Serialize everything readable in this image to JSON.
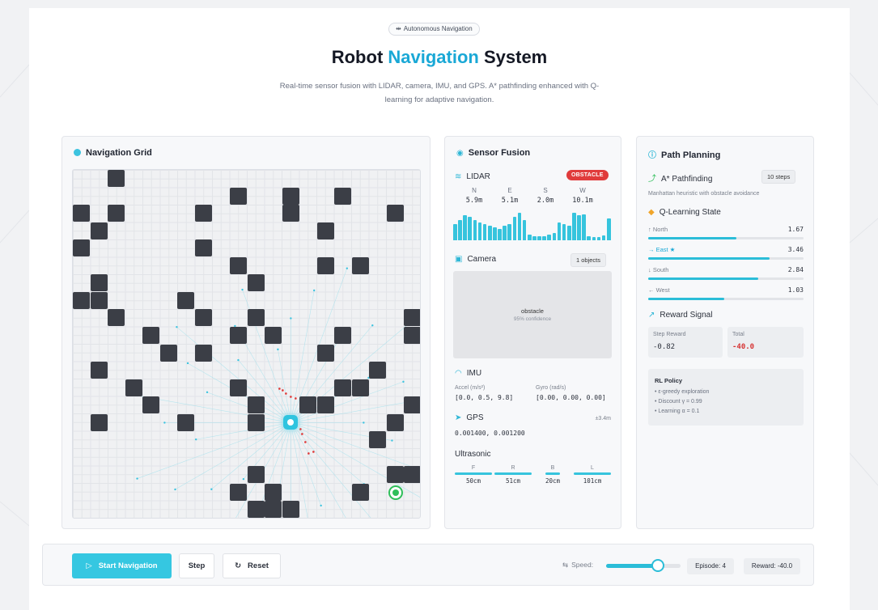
{
  "header": {
    "tag_icon": "link-icon",
    "tag": "Autonomous Navigation",
    "title_part1": "Robot ",
    "title_accent": "Navigation",
    "title_part2": " System",
    "subtitle": "Real-time sensor fusion with LIDAR, camera, IMU, and GPS. A* pathfinding enhanced with Q-learning for adaptive navigation."
  },
  "nav_grid": {
    "title": "Navigation Grid",
    "grid_size": 20,
    "robot_cell": [
      12,
      14
    ],
    "goal_cell": [
      18,
      18
    ],
    "obstacles": [
      [
        2,
        0
      ],
      [
        0,
        2
      ],
      [
        1,
        3
      ],
      [
        2,
        2
      ],
      [
        7,
        2
      ],
      [
        9,
        1
      ],
      [
        12,
        1
      ],
      [
        15,
        1
      ],
      [
        12,
        2
      ],
      [
        18,
        2
      ],
      [
        14,
        3
      ],
      [
        0,
        4
      ],
      [
        7,
        4
      ],
      [
        9,
        5
      ],
      [
        14,
        5
      ],
      [
        16,
        5
      ],
      [
        10,
        6
      ],
      [
        1,
        6
      ],
      [
        0,
        7
      ],
      [
        1,
        7
      ],
      [
        6,
        7
      ],
      [
        10,
        8
      ],
      [
        2,
        8
      ],
      [
        7,
        8
      ],
      [
        19,
        8
      ],
      [
        4,
        9
      ],
      [
        9,
        9
      ],
      [
        11,
        9
      ],
      [
        15,
        9
      ],
      [
        19,
        9
      ],
      [
        5,
        10
      ],
      [
        7,
        10
      ],
      [
        14,
        10
      ],
      [
        17,
        11
      ],
      [
        1,
        11
      ],
      [
        3,
        12
      ],
      [
        9,
        12
      ],
      [
        15,
        12
      ],
      [
        16,
        12
      ],
      [
        4,
        13
      ],
      [
        10,
        13
      ],
      [
        13,
        13
      ],
      [
        14,
        13
      ],
      [
        19,
        13
      ],
      [
        1,
        14
      ],
      [
        6,
        14
      ],
      [
        10,
        14
      ],
      [
        18,
        14
      ],
      [
        17,
        15
      ],
      [
        10,
        17
      ],
      [
        18,
        17
      ],
      [
        19,
        17
      ],
      [
        9,
        18
      ],
      [
        11,
        18
      ],
      [
        16,
        18
      ],
      [
        10,
        19
      ],
      [
        11,
        19
      ],
      [
        12,
        19
      ]
    ]
  },
  "sensor": {
    "title": "Sensor Fusion",
    "lidar_label": "LIDAR",
    "lidar_badge": "OBSTACLE",
    "lidar_dirs": [
      {
        "dir": "N",
        "val": "5.9m"
      },
      {
        "dir": "E",
        "val": "5.1m"
      },
      {
        "dir": "S",
        "val": "2.0m"
      },
      {
        "dir": "W",
        "val": "10.1m"
      }
    ],
    "lidar_bars": [
      0.55,
      0.7,
      0.85,
      0.8,
      0.7,
      0.6,
      0.55,
      0.5,
      0.45,
      0.4,
      0.5,
      0.55,
      0.8,
      0.95,
      0.7,
      0.2,
      0.15,
      0.15,
      0.15,
      0.2,
      0.25,
      0.6,
      0.55,
      0.5,
      0.95,
      0.85,
      0.9,
      0.15,
      0.12,
      0.12,
      0.18,
      0.75
    ],
    "camera_label": "Camera",
    "camera_badge": "1 objects",
    "camera_detect": "obstacle",
    "camera_conf": "95% confidence",
    "imu_label": "IMU",
    "accel_label": "Accel (m/s²)",
    "accel_val": "[0.0, 0.5, 9.8]",
    "gyro_label": "Gyro (rad/s)",
    "gyro_val": "[0.00, 0.00, 0.00]",
    "gps_label": "GPS",
    "gps_acc": "±3.4m",
    "gps_val": "0.001400, 0.001200",
    "ultra_label": "Ultrasonic",
    "ultra": [
      {
        "dir": "F",
        "val": "50cm",
        "level": 1.0
      },
      {
        "dir": "R",
        "val": "51cm",
        "level": 1.0
      },
      {
        "dir": "B",
        "val": "20cm",
        "level": 0.4
      },
      {
        "dir": "L",
        "val": "101cm",
        "level": 1.0
      }
    ]
  },
  "planning": {
    "title": "Path Planning",
    "astar_label": "A* Pathfinding",
    "astar_badge": "10 steps",
    "astar_desc": "Manhattan heuristic with obstacle avoidance",
    "q_label": "Q-Learning State",
    "q_values": [
      {
        "label": "↑ North",
        "val": "1.67",
        "level": 0.57,
        "active": false
      },
      {
        "label": "→ East ★",
        "val": "3.46",
        "level": 0.78,
        "active": true
      },
      {
        "label": "↓ South",
        "val": "2.84",
        "level": 0.71,
        "active": false
      },
      {
        "label": "← West",
        "val": "1.03",
        "level": 0.49,
        "active": false
      }
    ],
    "reward_label": "Reward Signal",
    "step_reward_label": "Step Reward",
    "step_reward": "-0.82",
    "total_label": "Total",
    "total": "-40.0",
    "policy_title": "RL Policy",
    "policy_items": [
      "• ε-greedy exploration",
      "• Discount γ = 0.99",
      "• Learning α = 0.1"
    ]
  },
  "controls": {
    "start": "Start Navigation",
    "step": "Step",
    "reset": "Reset",
    "speed_label": "Speed:",
    "speed_level": 0.7,
    "episode": "Episode: 4",
    "reward": "Reward: -40.0"
  },
  "colors": {
    "accent": "#1aa8d6",
    "obstacle": "#3b3e46",
    "danger": "#e03b3b",
    "goal": "#2fbf5a"
  }
}
